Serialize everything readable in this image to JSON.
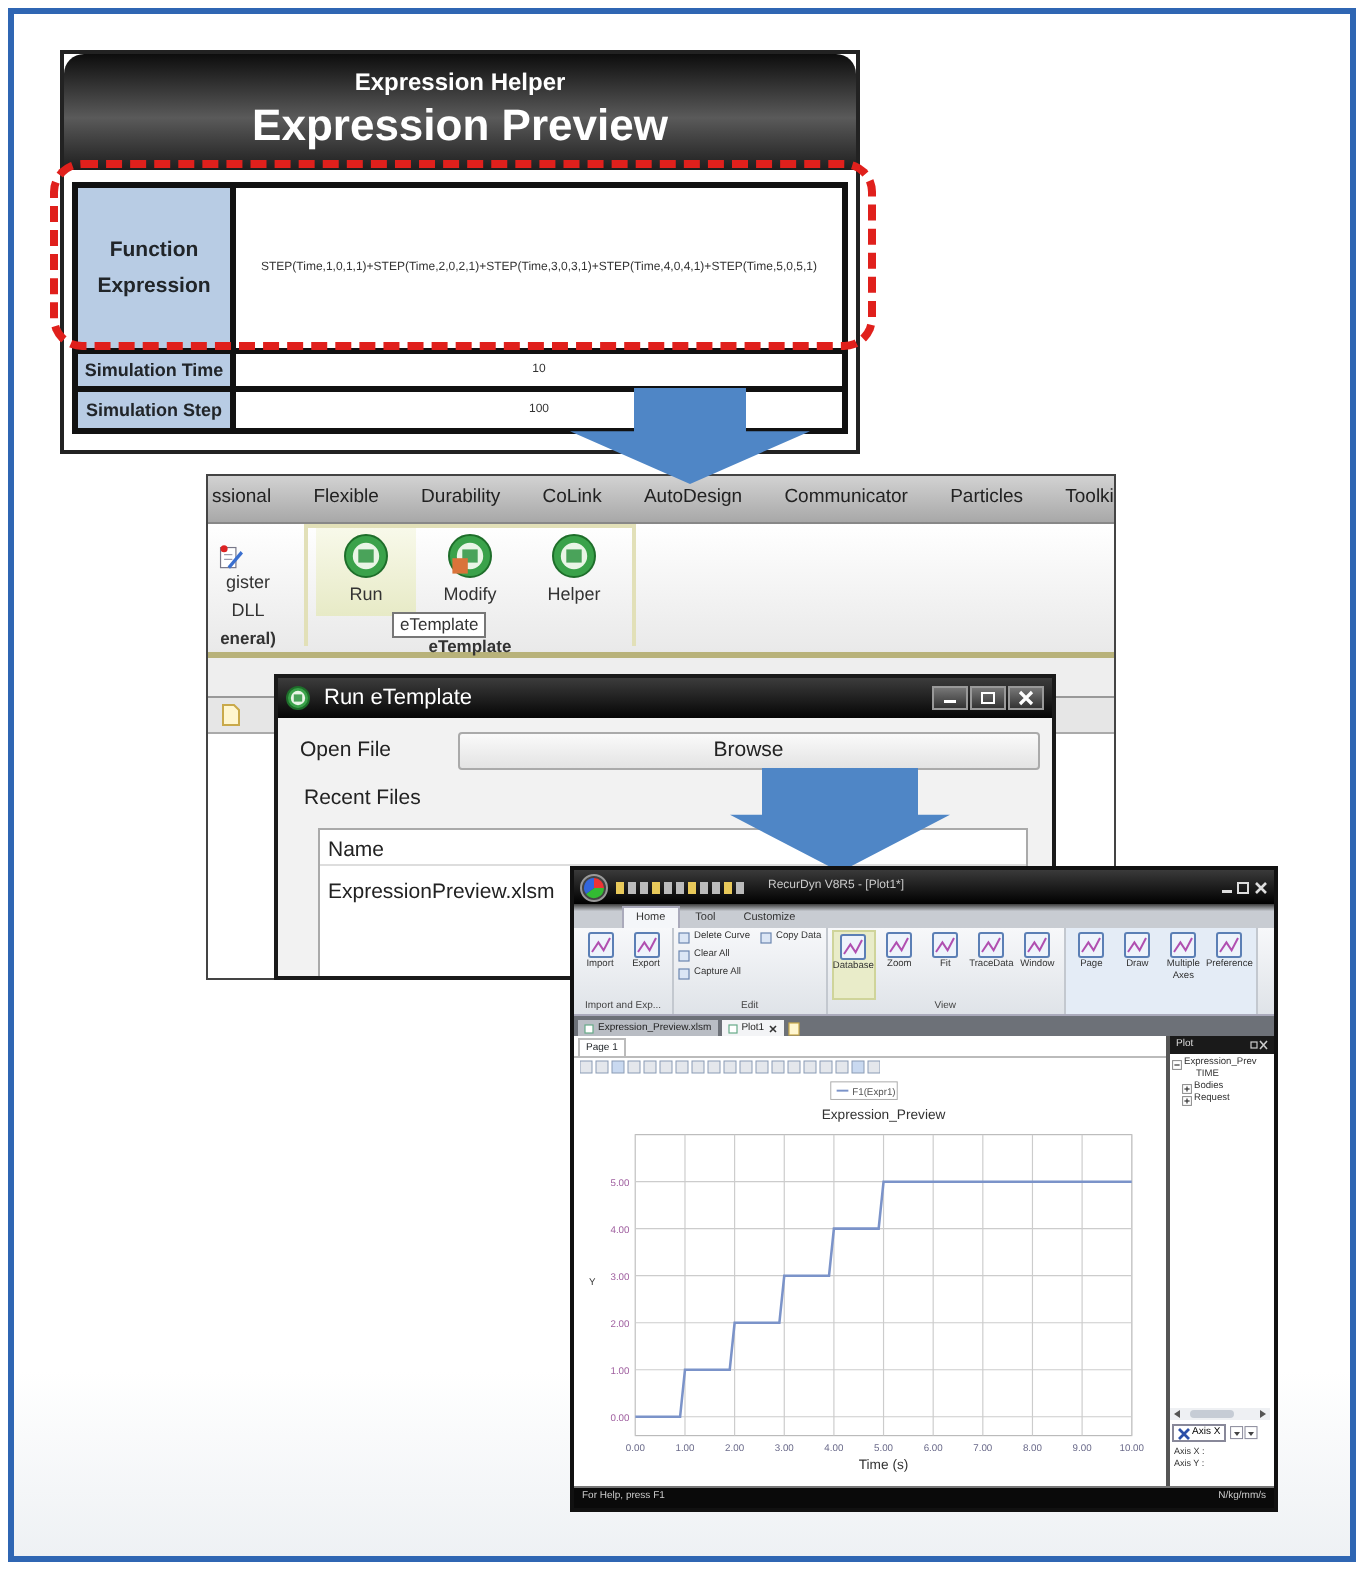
{
  "expression_helper": {
    "subtitle": "Expression Helper",
    "title": "Expression Preview",
    "rows": [
      {
        "label": "Function Expression",
        "value": "STEP(Time,1,0,1,1)+STEP(Time,2,0,2,1)+STEP(Time,3,0,3,1)+STEP(Time,4,0,4,1)+STEP(Time,5,0,5,1)"
      },
      {
        "label": "Simulation Time",
        "value": "10"
      },
      {
        "label": "Simulation Step",
        "value": "100"
      }
    ]
  },
  "ribbon_window": {
    "tabs": [
      "ssional",
      "Flexible",
      "Durability",
      "CoLink",
      "AutoDesign",
      "Communicator",
      "Particles",
      "Toolki"
    ],
    "left_button": {
      "label": "gister DLL",
      "group": "eneral)"
    },
    "group": {
      "label": "eTemplate",
      "buttons": [
        {
          "label": "Run",
          "selected": true
        },
        {
          "label": "Modify",
          "selected": false
        },
        {
          "label": "Helper",
          "selected": false
        }
      ]
    },
    "tooltip": "eTemplate"
  },
  "run_dialog": {
    "title": "Run eTemplate",
    "open_file_label": "Open File",
    "browse_button": "Browse",
    "recent_files_label": "Recent Files",
    "column": "Name",
    "files": [
      "ExpressionPreview.xlsm"
    ]
  },
  "plot_window": {
    "title": "RecurDyn V8R5 - [Plot1*]",
    "tabs": [
      {
        "label": "Home",
        "selected": true
      },
      {
        "label": "Tool",
        "selected": false
      },
      {
        "label": "Customize",
        "selected": false
      }
    ],
    "groups": [
      {
        "label": "Import and Exp...",
        "items": [
          {
            "label": "Import",
            "kind": "large",
            "selected": false
          },
          {
            "label": "Export",
            "kind": "large",
            "selected": false
          }
        ]
      },
      {
        "label": "Edit",
        "items": [
          {
            "label": "Delete Curve",
            "kind": "small"
          },
          {
            "label": "Copy Data",
            "kind": "small"
          },
          {
            "label": "Clear All",
            "kind": "small"
          },
          {
            "label": "Capture All",
            "kind": "small"
          }
        ]
      },
      {
        "label": "View",
        "items": [
          {
            "label": "Database",
            "kind": "large",
            "selected": true
          },
          {
            "label": "Zoom",
            "kind": "large",
            "selected": false
          },
          {
            "label": "Fit",
            "kind": "large",
            "selected": false
          },
          {
            "label": "TraceData",
            "kind": "large",
            "selected": false
          },
          {
            "label": "Window",
            "kind": "large",
            "selected": false
          }
        ]
      },
      {
        "items": [
          {
            "label": "Page",
            "kind": "large",
            "selected": false
          },
          {
            "label": "Draw",
            "kind": "large",
            "selected": false
          },
          {
            "label": "Multiple Axes",
            "kind": "large",
            "selected": false
          },
          {
            "label": "Preference",
            "kind": "large",
            "selected": false
          }
        ]
      }
    ],
    "doc_tabs": [
      {
        "label": "Expression_Preview.xlsm",
        "selected": false
      },
      {
        "label": "Plot1",
        "selected": true
      }
    ],
    "page_tab": "Page 1",
    "chart_data": {
      "type": "line",
      "title": "Expression_Preview",
      "xlabel": "Time (s)",
      "ylabel": "Y",
      "x": [
        0,
        0.9,
        1,
        1.9,
        2,
        2.9,
        3,
        3.9,
        4,
        4.9,
        5,
        10
      ],
      "series": [
        {
          "name": "F1(Expr1)",
          "color": "#7b93c9",
          "values": [
            0,
            0,
            1,
            1,
            2,
            2,
            3,
            3,
            4,
            4,
            5,
            5
          ]
        }
      ],
      "xlim": [
        0,
        10
      ],
      "ylim": [
        -0.4,
        6
      ],
      "grid": true,
      "xticks": [
        {
          "value": 0,
          "label": "0.00"
        },
        {
          "value": 1,
          "label": "1.00"
        },
        {
          "value": 2,
          "label": "2.00"
        },
        {
          "value": 3,
          "label": "3.00"
        },
        {
          "value": 4,
          "label": "4.00"
        },
        {
          "value": 5,
          "label": "5.00"
        },
        {
          "value": 6,
          "label": "6.00"
        },
        {
          "value": 7,
          "label": "7.00"
        },
        {
          "value": 8,
          "label": "8.00"
        },
        {
          "value": 9,
          "label": "9.00"
        },
        {
          "value": 10,
          "label": "10.00"
        }
      ],
      "yticks": [
        {
          "value": 0,
          "label": "0.00"
        },
        {
          "value": 1,
          "label": "1.00"
        },
        {
          "value": 2,
          "label": "2.00"
        },
        {
          "value": 3,
          "label": "3.00"
        },
        {
          "value": 4,
          "label": "4.00"
        },
        {
          "value": 5,
          "label": "5.00"
        }
      ]
    },
    "side_panel": {
      "title": "Plot",
      "tree": [
        {
          "label": "Expression_Prev",
          "expanded": true,
          "children": [
            {
              "label": "TIME"
            },
            {
              "label": "Bodies",
              "expanded": false
            },
            {
              "label": "Request",
              "expanded": false
            }
          ]
        }
      ],
      "axis_button": "Axis X",
      "axis_x": "Axis X :",
      "axis_y": "Axis Y :"
    },
    "status_bar": [
      "For Help, press F1",
      "N/kg/mm/s"
    ]
  }
}
